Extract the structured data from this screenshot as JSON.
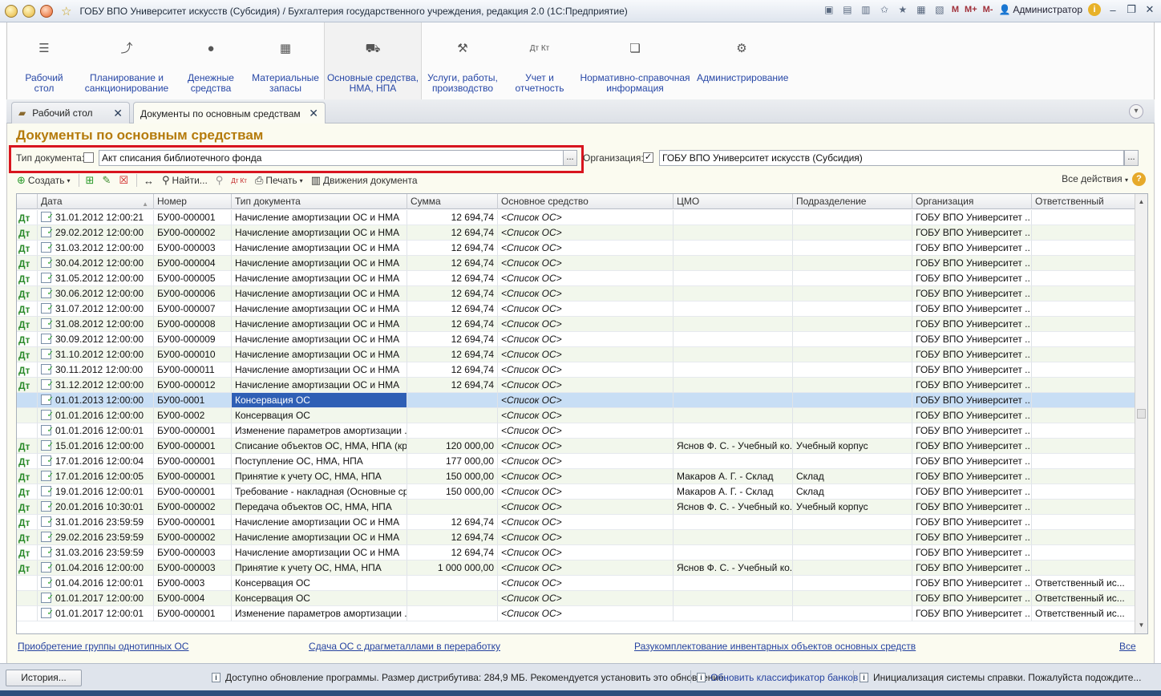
{
  "window": {
    "title": "ГОБУ ВПО Университет искусств (Субсидия) / Бухгалтерия государственного учреждения, редакция 2.0  (1С:Предприятие)",
    "user": "Администратор",
    "m_buttons": [
      "M",
      "M+",
      "M-"
    ]
  },
  "sections": [
    {
      "label": "Рабочий\nстол",
      "icon": "menu-icon"
    },
    {
      "label": "Планирование и\nсанкционирование",
      "icon": "planning-icon"
    },
    {
      "label": "Денежные\nсредства",
      "icon": "money-icon"
    },
    {
      "label": "Материальные\nзапасы",
      "icon": "materials-icon"
    },
    {
      "label": "Основные средства,\nНМА, НПА",
      "icon": "truck-icon"
    },
    {
      "label": "Услуги, работы,\nпроизводство",
      "icon": "tools-icon"
    },
    {
      "label": "Учет и\nотчетность",
      "icon": "accounting-icon"
    },
    {
      "label": "Нормативно-справочная\nинформация",
      "icon": "reference-icon"
    },
    {
      "label": "Администрирование",
      "icon": "gear-icon"
    }
  ],
  "tabs": [
    {
      "label": "Рабочий стол"
    },
    {
      "label": "Документы по основным средствам"
    }
  ],
  "form": {
    "title": "Документы по основным средствам",
    "doc_type_label": "Тип документа:",
    "doc_type_value": "Акт списания библиотечного фонда",
    "org_label": "Организация:",
    "org_value": "ГОБУ ВПО Университет искусств (Субсидия)",
    "ellipsis": "..."
  },
  "toolbar": {
    "create": "Создать",
    "find": "Найти...",
    "print": "Печать",
    "movements": "Движения документа",
    "all_actions": "Все действия"
  },
  "columns": [
    "Дата",
    "Номер",
    "Тип документа",
    "Сумма",
    "Основное средство",
    "ЦМО",
    "Подразделение",
    "Организация",
    "Ответственный"
  ],
  "rows": [
    {
      "dk": true,
      "date": "31.01.2012 12:00:21",
      "num": "БУ00-000001",
      "type": "Начисление амортизации ОС и НМА",
      "sum": "12 694,74",
      "os": "<Список ОС>",
      "cmo": "",
      "dep": "",
      "org": "ГОБУ ВПО Университет ...",
      "resp": ""
    },
    {
      "dk": true,
      "date": "29.02.2012 12:00:00",
      "num": "БУ00-000002",
      "type": "Начисление амортизации ОС и НМА",
      "sum": "12 694,74",
      "os": "<Список ОС>",
      "cmo": "",
      "dep": "",
      "org": "ГОБУ ВПО Университет ...",
      "resp": ""
    },
    {
      "dk": true,
      "date": "31.03.2012 12:00:00",
      "num": "БУ00-000003",
      "type": "Начисление амортизации ОС и НМА",
      "sum": "12 694,74",
      "os": "<Список ОС>",
      "cmo": "",
      "dep": "",
      "org": "ГОБУ ВПО Университет ...",
      "resp": ""
    },
    {
      "dk": true,
      "date": "30.04.2012 12:00:00",
      "num": "БУ00-000004",
      "type": "Начисление амортизации ОС и НМА",
      "sum": "12 694,74",
      "os": "<Список ОС>",
      "cmo": "",
      "dep": "",
      "org": "ГОБУ ВПО Университет ...",
      "resp": ""
    },
    {
      "dk": true,
      "date": "31.05.2012 12:00:00",
      "num": "БУ00-000005",
      "type": "Начисление амортизации ОС и НМА",
      "sum": "12 694,74",
      "os": "<Список ОС>",
      "cmo": "",
      "dep": "",
      "org": "ГОБУ ВПО Университет ...",
      "resp": ""
    },
    {
      "dk": true,
      "date": "30.06.2012 12:00:00",
      "num": "БУ00-000006",
      "type": "Начисление амортизации ОС и НМА",
      "sum": "12 694,74",
      "os": "<Список ОС>",
      "cmo": "",
      "dep": "",
      "org": "ГОБУ ВПО Университет ...",
      "resp": ""
    },
    {
      "dk": true,
      "date": "31.07.2012 12:00:00",
      "num": "БУ00-000007",
      "type": "Начисление амортизации ОС и НМА",
      "sum": "12 694,74",
      "os": "<Список ОС>",
      "cmo": "",
      "dep": "",
      "org": "ГОБУ ВПО Университет ...",
      "resp": ""
    },
    {
      "dk": true,
      "date": "31.08.2012 12:00:00",
      "num": "БУ00-000008",
      "type": "Начисление амортизации ОС и НМА",
      "sum": "12 694,74",
      "os": "<Список ОС>",
      "cmo": "",
      "dep": "",
      "org": "ГОБУ ВПО Университет ...",
      "resp": ""
    },
    {
      "dk": true,
      "date": "30.09.2012 12:00:00",
      "num": "БУ00-000009",
      "type": "Начисление амортизации ОС и НМА",
      "sum": "12 694,74",
      "os": "<Список ОС>",
      "cmo": "",
      "dep": "",
      "org": "ГОБУ ВПО Университет ...",
      "resp": ""
    },
    {
      "dk": true,
      "date": "31.10.2012 12:00:00",
      "num": "БУ00-000010",
      "type": "Начисление амортизации ОС и НМА",
      "sum": "12 694,74",
      "os": "<Список ОС>",
      "cmo": "",
      "dep": "",
      "org": "ГОБУ ВПО Университет ...",
      "resp": ""
    },
    {
      "dk": true,
      "date": "30.11.2012 12:00:00",
      "num": "БУ00-000011",
      "type": "Начисление амортизации ОС и НМА",
      "sum": "12 694,74",
      "os": "<Список ОС>",
      "cmo": "",
      "dep": "",
      "org": "ГОБУ ВПО Университет ...",
      "resp": ""
    },
    {
      "dk": true,
      "date": "31.12.2012 12:00:00",
      "num": "БУ00-000012",
      "type": "Начисление амортизации ОС и НМА",
      "sum": "12 694,74",
      "os": "<Список ОС>",
      "cmo": "",
      "dep": "",
      "org": "ГОБУ ВПО Университет ...",
      "resp": ""
    },
    {
      "dk": false,
      "selected": true,
      "date": "01.01.2013 12:00:00",
      "num": "БУ00-0001",
      "type": "Консервация ОС",
      "sum": "",
      "os": "<Список ОС>",
      "cmo": "",
      "dep": "",
      "org": "ГОБУ ВПО Университет ...",
      "resp": ""
    },
    {
      "dk": false,
      "date": "01.01.2016 12:00:00",
      "num": "БУ00-0002",
      "type": "Консервация ОС",
      "sum": "",
      "os": "<Список ОС>",
      "cmo": "",
      "dep": "",
      "org": "ГОБУ ВПО Университет ...",
      "resp": ""
    },
    {
      "dk": false,
      "date": "01.01.2016 12:00:01",
      "num": "БУ00-000001",
      "type": "Изменение параметров амортизации ...",
      "sum": "",
      "os": "<Список ОС>",
      "cmo": "",
      "dep": "",
      "org": "ГОБУ ВПО Университет ...",
      "resp": ""
    },
    {
      "dk": true,
      "date": "15.01.2016 12:00:00",
      "num": "БУ00-000001",
      "type": "Списание объектов ОС, НМА, НПА (кро...",
      "sum": "120 000,00",
      "os": "<Список ОС>",
      "cmo": "Яснов Ф. С. - Учебный ко...",
      "dep": "Учебный корпус",
      "org": "ГОБУ ВПО Университет ...",
      "resp": ""
    },
    {
      "dk": true,
      "date": "17.01.2016 12:00:04",
      "num": "БУ00-000001",
      "type": "Поступление ОС, НМА, НПА",
      "sum": "177 000,00",
      "os": "<Список ОС>",
      "cmo": "",
      "dep": "",
      "org": "ГОБУ ВПО Университет ...",
      "resp": ""
    },
    {
      "dk": true,
      "date": "17.01.2016 12:00:05",
      "num": "БУ00-000001",
      "type": "Принятие к учету ОС, НМА, НПА",
      "sum": "150 000,00",
      "os": "<Список ОС>",
      "cmo": "Макаров А. Г. - Склад",
      "dep": "Склад",
      "org": "ГОБУ ВПО Университет ...",
      "resp": ""
    },
    {
      "dk": true,
      "date": "19.01.2016 12:00:01",
      "num": "БУ00-000001",
      "type": "Требование - накладная (Основные ср...",
      "sum": "150 000,00",
      "os": "<Список ОС>",
      "cmo": "Макаров А. Г. - Склад",
      "dep": "Склад",
      "org": "ГОБУ ВПО Университет ...",
      "resp": ""
    },
    {
      "dk": true,
      "date": "20.01.2016 10:30:01",
      "num": "БУ00-000002",
      "type": "Передача объектов ОС, НМА, НПА",
      "sum": "",
      "os": "<Список ОС>",
      "cmo": "Яснов Ф. С. - Учебный ко...",
      "dep": "Учебный корпус",
      "org": "ГОБУ ВПО Университет ...",
      "resp": ""
    },
    {
      "dk": true,
      "date": "31.01.2016 23:59:59",
      "num": "БУ00-000001",
      "type": "Начисление амортизации ОС и НМА",
      "sum": "12 694,74",
      "os": "<Список ОС>",
      "cmo": "",
      "dep": "",
      "org": "ГОБУ ВПО Университет ...",
      "resp": ""
    },
    {
      "dk": true,
      "date": "29.02.2016 23:59:59",
      "num": "БУ00-000002",
      "type": "Начисление амортизации ОС и НМА",
      "sum": "12 694,74",
      "os": "<Список ОС>",
      "cmo": "",
      "dep": "",
      "org": "ГОБУ ВПО Университет ...",
      "resp": ""
    },
    {
      "dk": true,
      "date": "31.03.2016 23:59:59",
      "num": "БУ00-000003",
      "type": "Начисление амортизации ОС и НМА",
      "sum": "12 694,74",
      "os": "<Список ОС>",
      "cmo": "",
      "dep": "",
      "org": "ГОБУ ВПО Университет ...",
      "resp": ""
    },
    {
      "dk": true,
      "date": "01.04.2016 12:00:00",
      "num": "БУ00-000003",
      "type": "Принятие к учету ОС, НМА, НПА",
      "sum": "1 000 000,00",
      "os": "<Список ОС>",
      "cmo": "Яснов Ф. С. - Учебный ко...",
      "dep": "",
      "org": "ГОБУ ВПО Университет ...",
      "resp": ""
    },
    {
      "dk": false,
      "date": "01.04.2016 12:00:01",
      "num": "БУ00-0003",
      "type": "Консервация ОС",
      "sum": "",
      "os": "<Список ОС>",
      "cmo": "",
      "dep": "",
      "org": "ГОБУ ВПО Университет ...",
      "resp": "Ответственный ис..."
    },
    {
      "dk": false,
      "date": "01.01.2017 12:00:00",
      "num": "БУ00-0004",
      "type": "Консервация ОС",
      "sum": "",
      "os": "<Список ОС>",
      "cmo": "",
      "dep": "",
      "org": "ГОБУ ВПО Университет ...",
      "resp": "Ответственный ис..."
    },
    {
      "dk": false,
      "date": "01.01.2017 12:00:01",
      "num": "БУ00-000001",
      "type": "Изменение параметров амортизации ...",
      "sum": "",
      "os": "<Список ОС>",
      "cmo": "",
      "dep": "",
      "org": "ГОБУ ВПО Университет ...",
      "resp": "Ответственный ис..."
    }
  ],
  "bottom_links": [
    "Приобретение группы однотипных ОС",
    "Сдача ОС с драгметаллами в переработку",
    "Разукомплектование инвентарных объектов основных средств",
    "Все"
  ],
  "status": {
    "history": "История...",
    "msg1": "Доступно обновление программы. Размер дистрибутива: 284,9 МБ. Рекомендуется установить это обновление.",
    "msg2": "Обновить классификатор банков",
    "msg3": "Инициализация системы справки. Пожалуйста подождите..."
  },
  "dk_labels": {
    "d": "Дт",
    "k": "Кт"
  }
}
